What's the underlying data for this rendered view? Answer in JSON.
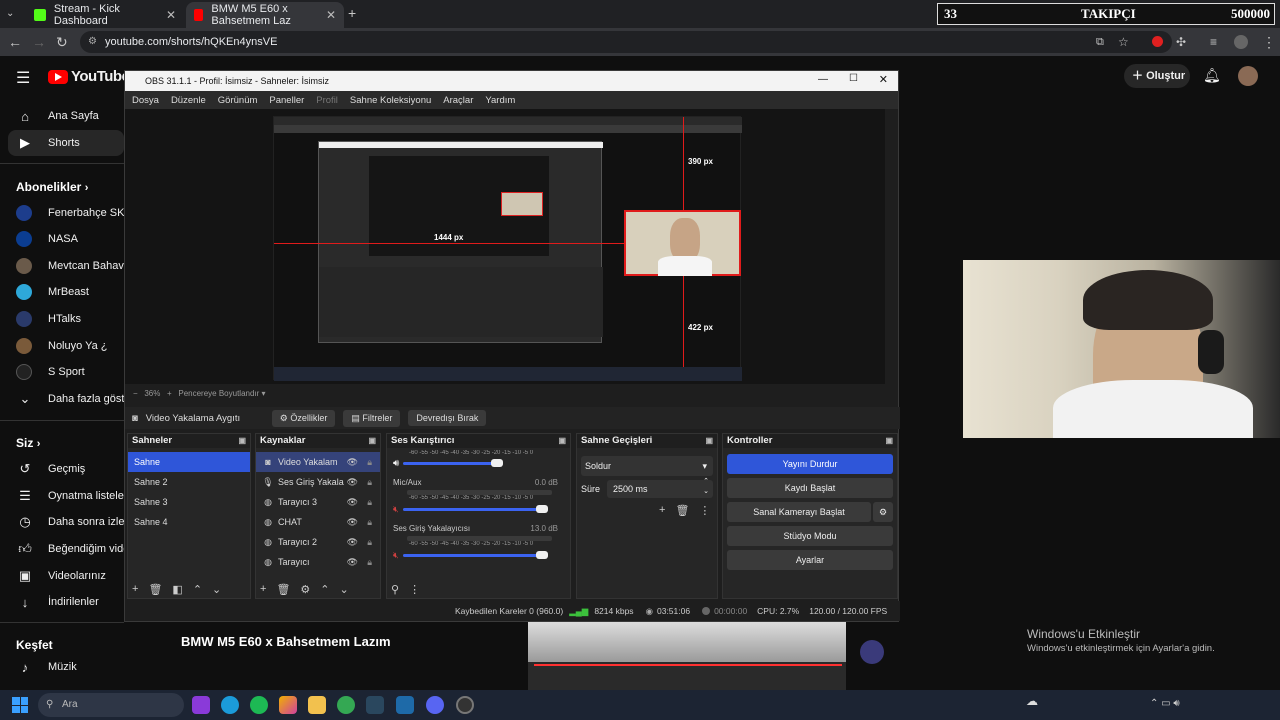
{
  "browser": {
    "tabs": [
      {
        "label": "Stream - Kick Dashboard",
        "color": "#53fc18"
      },
      {
        "label": "BMW M5 E60 x Bahsetmem Laz",
        "color": "#ff0000"
      }
    ],
    "url": "youtube.com/shorts/hQKEn4ynsVE",
    "overlay": {
      "left": "33",
      "center": "TAKIPÇI",
      "right": "500000"
    }
  },
  "youtube": {
    "logo": "YouTube",
    "logo_sup": "TR",
    "create_label": "Oluştur",
    "nav": [
      {
        "label": "Ana Sayfa",
        "icon": "home-icon"
      },
      {
        "label": "Shorts",
        "icon": "shorts-icon"
      }
    ],
    "subs_title": "Abonelikler",
    "channels": [
      {
        "label": "Fenerbahçe SK",
        "color": "#1d3d8c"
      },
      {
        "label": "NASA",
        "color": "#0b3d91"
      },
      {
        "label": "Mevtcan Bahav",
        "color": "#6a5a4a"
      },
      {
        "label": "MrBeast",
        "color": "#2ea8d9"
      },
      {
        "label": "HTalks",
        "color": "#2a3a6a"
      },
      {
        "label": "Noluyo Ya ¿",
        "color": "#7a5a3a"
      },
      {
        "label": "S Sport",
        "color": "#222222"
      }
    ],
    "more_label": "Daha fazla göster",
    "you_title": "Siz",
    "you_items": [
      {
        "label": "Geçmiş",
        "icon": "history-icon"
      },
      {
        "label": "Oynatma listeleri",
        "icon": "playlists-icon"
      },
      {
        "label": "Daha sonra izle",
        "icon": "watch-later-icon"
      },
      {
        "label": "Beğendiğim videol",
        "icon": "like-icon"
      },
      {
        "label": "Videolarınız",
        "icon": "your-videos-icon"
      },
      {
        "label": "İndirilenler",
        "icon": "download-icon"
      }
    ],
    "explore_title": "Keşfet",
    "explore_items": [
      {
        "label": "Müzik",
        "icon": "music-icon"
      }
    ],
    "video_title": "BMW M5 E60 x Bahsetmem Lazım"
  },
  "obs": {
    "title": "OBS 31.1.1 - Profil: İsimsiz - Sahneler: İsimsiz",
    "menu": [
      "Dosya",
      "Düzenle",
      "Görünüm",
      "Paneller",
      "Profil",
      "Sahne Koleksiyonu",
      "Araçlar",
      "Yardım"
    ],
    "preview": {
      "px_top": "390 px",
      "px_bottom": "422 px",
      "px_left": "1444 px"
    },
    "zoom": "36%",
    "fit_label": "Pencereye Boyutlandır",
    "source_name": "Video Yakalama Aygıtı",
    "toolbar": {
      "properties": "Özellikler",
      "filters": "Filtreler",
      "deactivate": "Devredışı Bırak"
    },
    "scenes": {
      "title": "Sahneler",
      "items": [
        "Sahne",
        "Sahne 2",
        "Sahne 3",
        "Sahne 4"
      ]
    },
    "sources": {
      "title": "Kaynaklar",
      "items": [
        {
          "label": "Video Yakalam",
          "icon": "camera-icon"
        },
        {
          "label": "Ses Giriş Yakala",
          "icon": "mic-icon"
        },
        {
          "label": "Tarayıcı 3",
          "icon": "globe-icon"
        },
        {
          "label": "CHAT",
          "icon": "text-icon"
        },
        {
          "label": "Tarayıcı 2",
          "icon": "globe-icon"
        },
        {
          "label": "Tarayıcı",
          "icon": "globe-icon"
        }
      ]
    },
    "mixer": {
      "title": "Ses Karıştırıcı",
      "scale": "-60 -55 -50 -45 -40 -35 -30 -25 -20 -15 -10 -5 0",
      "channels": [
        {
          "name": "Mic/Aux",
          "db": "0.0 dB"
        },
        {
          "name": "Ses Giriş Yakalayıcısı",
          "db": "13.0 dB"
        }
      ]
    },
    "transitions": {
      "title": "Sahne Geçişleri",
      "type": "Soldur",
      "duration_label": "Süre",
      "duration": "2500 ms"
    },
    "controls": {
      "title": "Kontroller",
      "buttons": [
        "Yayını Durdur",
        "Kaydı Başlat",
        "Sanal Kamerayı Başlat",
        "Stüdyo Modu",
        "Ayarlar"
      ]
    },
    "status": {
      "dropped": "Kaybedilen Kareler 0 (960.0)",
      "bitrate": "8214 kbps",
      "live_time": "03:51:06",
      "rec_time": "00:00:00",
      "cpu": "CPU: 2.7%",
      "fps": "120.00 / 120.00 FPS"
    }
  },
  "windows": {
    "activate_title": "Windows'u Etkinleştir",
    "activate_sub": "Windows'u etkinleştirmek için Ayarlar'a gidin.",
    "search": "Ara"
  }
}
